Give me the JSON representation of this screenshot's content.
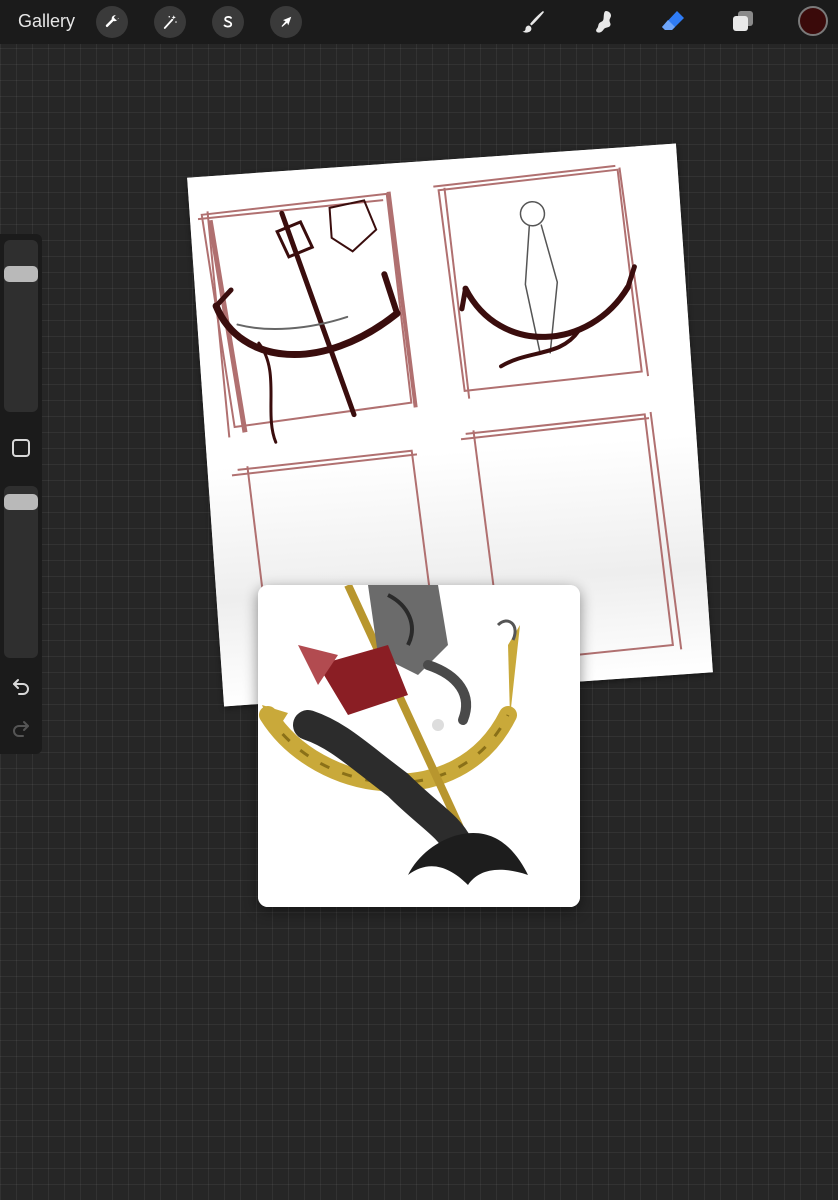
{
  "topbar": {
    "gallery_label": "Gallery",
    "actions": [
      {
        "id": "wrench",
        "icon": "wrench-icon"
      },
      {
        "id": "adjustments",
        "icon": "magic-wand-icon"
      },
      {
        "id": "selection",
        "icon": "selection-s-icon"
      },
      {
        "id": "transform",
        "icon": "arrow-cursor-icon"
      }
    ],
    "tools": [
      {
        "id": "brush",
        "icon": "brush-icon",
        "active": false
      },
      {
        "id": "smudge",
        "icon": "smudge-icon",
        "active": false
      },
      {
        "id": "eraser",
        "icon": "eraser-icon",
        "active": true
      },
      {
        "id": "layers",
        "icon": "layers-icon",
        "active": false
      }
    ],
    "current_color": "#3a0a0a"
  },
  "sidebar": {
    "brush_size_level": 0.05,
    "opacity_level": 0.05,
    "icons": [
      "modify-square-icon",
      "undo-icon",
      "redo-icon"
    ]
  },
  "colors": {
    "accent": "#2f7cf6",
    "sketch_ink": "#3a0d0d",
    "panel_border": "#b07070",
    "canvas_bg": "#262626",
    "toolbar_bg": "#1b1b1b"
  }
}
